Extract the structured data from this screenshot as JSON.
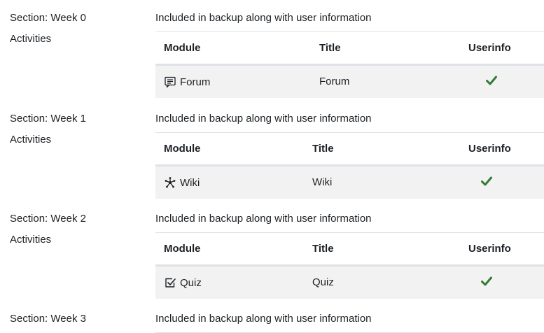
{
  "sections": [
    {
      "title": "Section: Week 0",
      "subtitle": "Activities",
      "included_text": "Included in backup along with user information",
      "columns": [
        "Module",
        "Title",
        "Userinfo"
      ],
      "rows": [
        {
          "module": "Forum",
          "module_icon": "forum-icon",
          "title": "Forum",
          "userinfo": "check-icon"
        }
      ]
    },
    {
      "title": "Section: Week 1",
      "subtitle": "Activities",
      "included_text": "Included in backup along with user information",
      "columns": [
        "Module",
        "Title",
        "Userinfo"
      ],
      "rows": [
        {
          "module": "Wiki",
          "module_icon": "wiki-icon",
          "title": "Wiki",
          "userinfo": "check-icon"
        }
      ]
    },
    {
      "title": "Section: Week 2",
      "subtitle": "Activities",
      "included_text": "Included in backup along with user information",
      "columns": [
        "Module",
        "Title",
        "Userinfo"
      ],
      "rows": [
        {
          "module": "Quiz",
          "module_icon": "quiz-icon",
          "title": "Quiz",
          "userinfo": "check-icon"
        }
      ]
    },
    {
      "title": "Section: Week 3",
      "included_text": "Included in backup along with user information"
    }
  ],
  "colors": {
    "check": "#357a32",
    "border": "#dee2e6",
    "row_bg": "#f2f2f2",
    "text": "#1d2125"
  }
}
